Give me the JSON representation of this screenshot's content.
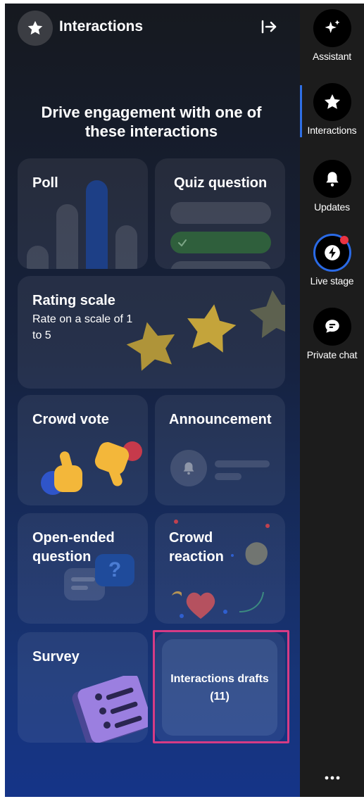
{
  "header": {
    "title": "Interactions",
    "headline": "Drive engagement with one of these interactions"
  },
  "cards": {
    "poll": {
      "title": "Poll"
    },
    "quiz": {
      "title": "Quiz question"
    },
    "rating": {
      "title": "Rating scale",
      "subtitle": "Rate on a scale of 1 to 5"
    },
    "crowd_vote": {
      "title": "Crowd vote"
    },
    "announcement": {
      "title": "Announcement"
    },
    "open_ended": {
      "title": "Open-ended question"
    },
    "crowd_reaction": {
      "title": "Crowd reaction"
    },
    "survey": {
      "title": "Survey"
    },
    "drafts": {
      "title": "Interactions drafts (11)"
    }
  },
  "rail": {
    "items": [
      {
        "label": "Assistant",
        "icon": "sparkle-icon"
      },
      {
        "label": "Interactions",
        "icon": "star-icon",
        "active": true
      },
      {
        "label": "Updates",
        "icon": "bell-icon"
      },
      {
        "label": "Live stage",
        "icon": "lightning-icon",
        "notification": true
      },
      {
        "label": "Private chat",
        "icon": "chat-icon"
      }
    ],
    "more_label": "•••"
  },
  "colors": {
    "accent": "#2f6fe4",
    "highlight": "#d63b85",
    "notification": "#ea3342"
  }
}
